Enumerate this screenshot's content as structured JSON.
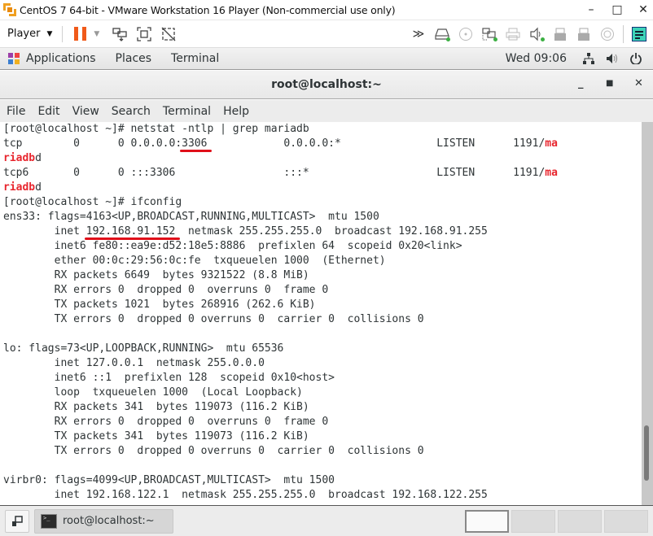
{
  "vmware": {
    "title": "CentOS 7 64-bit - VMware Workstation 16 Player (Non-commercial use only)",
    "player_menu": "Player",
    "window_controls": {
      "minimize": "–",
      "maximize": "□",
      "close": "✕"
    },
    "toolbar_icons": [
      "pause-icon",
      "send-ctrl-alt-del-icon",
      "fullscreen-icon",
      "unity-icon"
    ],
    "device_icons": [
      "more-icon",
      "hard-disk-icon",
      "cd-dvd-icon",
      "network-adapter-icon",
      "printer-icon",
      "sound-card-icon",
      "usb-icon-1",
      "usb-icon-2",
      "floppy-icon",
      "message-log-icon"
    ],
    "more_glyph": "≫"
  },
  "gnome": {
    "applications": "Applications",
    "places": "Places",
    "terminal": "Terminal",
    "clock": "Wed 09:06"
  },
  "terminal": {
    "title": "root@localhost:~",
    "menu": [
      "File",
      "Edit",
      "View",
      "Search",
      "Terminal",
      "Help"
    ],
    "lines": [
      {
        "t": "[root@localhost ~]# netstat -ntlp | grep mariadb"
      },
      {
        "pre": "tcp        0      0 0.0.0.0:",
        "u": "3306",
        "mid": "            0.0.0.0:*               LISTEN      1191/",
        "r": "ma"
      },
      {
        "r": "riadb",
        "post": "d"
      },
      {
        "pre": "tcp6       0      0 :::3306                 :::*                    LISTEN      1191/",
        "r": "ma"
      },
      {
        "r": "riadb",
        "post": "d"
      },
      {
        "t": "[root@localhost ~]# ifconfig"
      },
      {
        "t": "ens33: flags=4163<UP,BROADCAST,RUNNING,MULTICAST>  mtu 1500"
      },
      {
        "pre": "        inet ",
        "u": "192.168.91.152",
        "mid": "  netmask 255.255.255.0  broadcast 192.168.91.255"
      },
      {
        "t": "        inet6 fe80::ea9e:d52:18e5:8886  prefixlen 64  scopeid 0x20<link>"
      },
      {
        "t": "        ether 00:0c:29:56:0c:fe  txqueuelen 1000  (Ethernet)"
      },
      {
        "t": "        RX packets 6649  bytes 9321522 (8.8 MiB)"
      },
      {
        "t": "        RX errors 0  dropped 0  overruns 0  frame 0"
      },
      {
        "t": "        TX packets 1021  bytes 268916 (262.6 KiB)"
      },
      {
        "t": "        TX errors 0  dropped 0 overruns 0  carrier 0  collisions 0"
      },
      {
        "t": ""
      },
      {
        "t": "lo: flags=73<UP,LOOPBACK,RUNNING>  mtu 65536"
      },
      {
        "t": "        inet 127.0.0.1  netmask 255.0.0.0"
      },
      {
        "t": "        inet6 ::1  prefixlen 128  scopeid 0x10<host>"
      },
      {
        "t": "        loop  txqueuelen 1000  (Local Loopback)"
      },
      {
        "t": "        RX packets 341  bytes 119073 (116.2 KiB)"
      },
      {
        "t": "        RX errors 0  dropped 0  overruns 0  frame 0"
      },
      {
        "t": "        TX packets 341  bytes 119073 (116.2 KiB)"
      },
      {
        "t": "        TX errors 0  dropped 0 overruns 0  carrier 0  collisions 0"
      },
      {
        "t": ""
      },
      {
        "t": "virbr0: flags=4099<UP,BROADCAST,MULTICAST>  mtu 1500"
      },
      {
        "t": "        inet 192.168.122.1  netmask 255.255.255.0  broadcast 192.168.122.255"
      }
    ],
    "highlight_color": "#e8262e"
  },
  "taskbar": {
    "task_label": "root@localhost:~",
    "workspaces": 4,
    "active_workspace": 1
  }
}
